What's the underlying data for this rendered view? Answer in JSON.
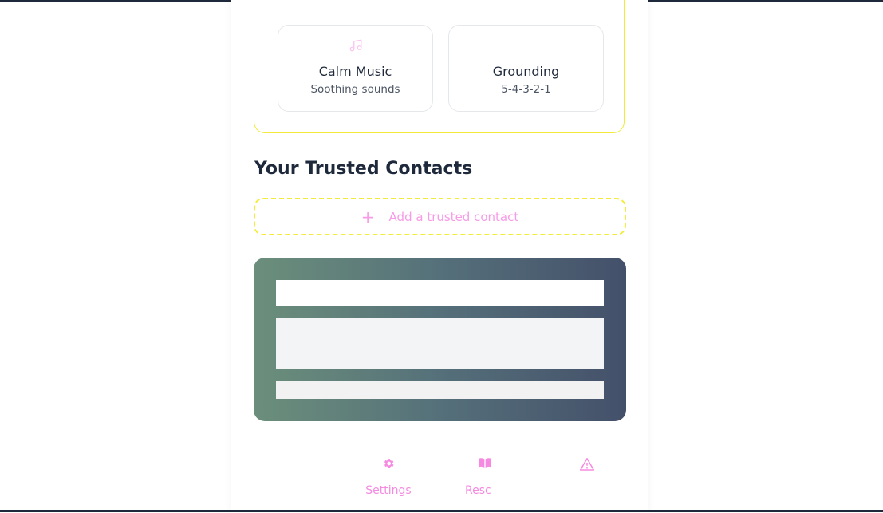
{
  "coping_tools": [
    {
      "title": "",
      "subtitle": "",
      "icon": "empty"
    },
    {
      "title": "",
      "subtitle": "",
      "icon": "empty"
    },
    {
      "title": "Calm Music",
      "subtitle": "Soothing sounds",
      "icon": "music-note-icon"
    },
    {
      "title": "Grounding",
      "subtitle": "5-4-3-2-1",
      "icon": "none"
    }
  ],
  "contacts": {
    "heading": "Your Trusted Contacts",
    "add_label": "Add a trusted contact",
    "add_icon": "plus-icon"
  },
  "bottom_nav": [
    {
      "label": "Settings",
      "icon": "gear-icon"
    },
    {
      "label": "Resc",
      "icon": "book-icon"
    },
    {
      "label": "",
      "icon": "warning-icon"
    }
  ],
  "colors": {
    "accent_yellow": "#f1ea3b",
    "accent_pink": "#f58ae0",
    "heading_text": "#1e293b",
    "gradient_start": "#6b8f7b",
    "gradient_end": "#44506a"
  }
}
